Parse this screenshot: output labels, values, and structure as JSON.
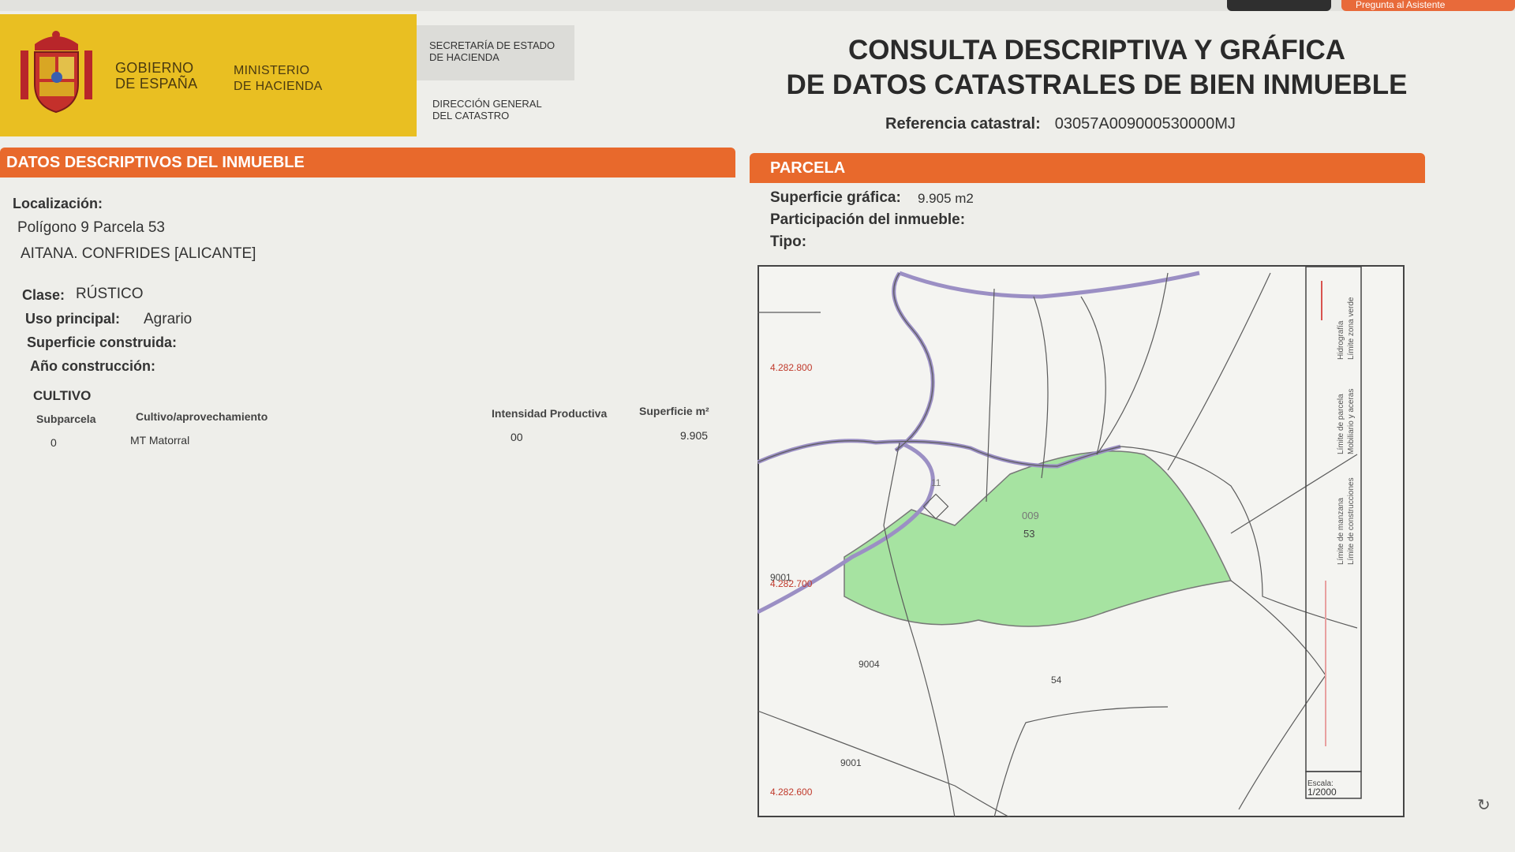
{
  "top_bar": {
    "assistant_label": "Pregunta al Asistente"
  },
  "header": {
    "gobierno": [
      "GOBIERNO",
      "DE ESPAÑA"
    ],
    "ministerio": [
      "MINISTERIO",
      "DE HACIENDA"
    ],
    "secretaria": [
      "SECRETARÍA DE ESTADO",
      "DE HACIENDA"
    ],
    "direccion": [
      "DIRECCIÓN GENERAL",
      "DEL CATASTRO"
    ],
    "title_line1": "CONSULTA DESCRIPTIVA Y GRÁFICA",
    "title_line2": "DE DATOS CATASTRALES DE BIEN INMUEBLE",
    "ref_label": "Referencia catastral:",
    "ref_value": "03057A009000530000MJ"
  },
  "descriptivos": {
    "section_title": "DATOS DESCRIPTIVOS DEL INMUEBLE",
    "localizacion_label": "Localización:",
    "localizacion_line1": "Polígono 9 Parcela 53",
    "localizacion_line2": "AITANA. CONFRIDES [ALICANTE]",
    "clase_label": "Clase:",
    "clase_value": "RÚSTICO",
    "uso_label": "Uso principal:",
    "uso_value": "Agrario",
    "superficie_construida_label": "Superficie construida:",
    "anio_label": "Año construcción:",
    "cultivo_title": "CULTIVO",
    "cultivo_headers": {
      "subparcela": "Subparcela",
      "cultivo": "Cultivo/aprovechamiento",
      "intensidad": "Intensidad Productiva",
      "superficie": "Superficie m²"
    },
    "cultivo_rows": [
      {
        "subparcela": "0",
        "cultivo": "MT Matorral",
        "intensidad": "00",
        "superficie": "9.905"
      }
    ]
  },
  "parcela": {
    "section_title": "PARCELA",
    "superficie_label": "Superficie gráfica:",
    "superficie_value": "9.905 m2",
    "participacion_label": "Participación del inmueble:",
    "tipo_label": "Tipo:",
    "map": {
      "coord_top": "4.282.800",
      "coord_mid": "4.282.700",
      "coord_bottom": "4.282.600",
      "parcel_label": "53",
      "parcel_poly": "009",
      "label_9001": "9001",
      "label_9004": "9004",
      "label_9001b": "9001",
      "label_11": "11",
      "label_54": "54",
      "scale_label": "Escala:",
      "scale_value": "1/2000",
      "legend": [
        "Hidrografía",
        "Límite zona verde",
        "Límite de parcela",
        "Mobiliario y aceras",
        "Límite de manzana",
        "Límite de construcciones"
      ],
      "parcel_color": "#a6e3a1"
    }
  }
}
